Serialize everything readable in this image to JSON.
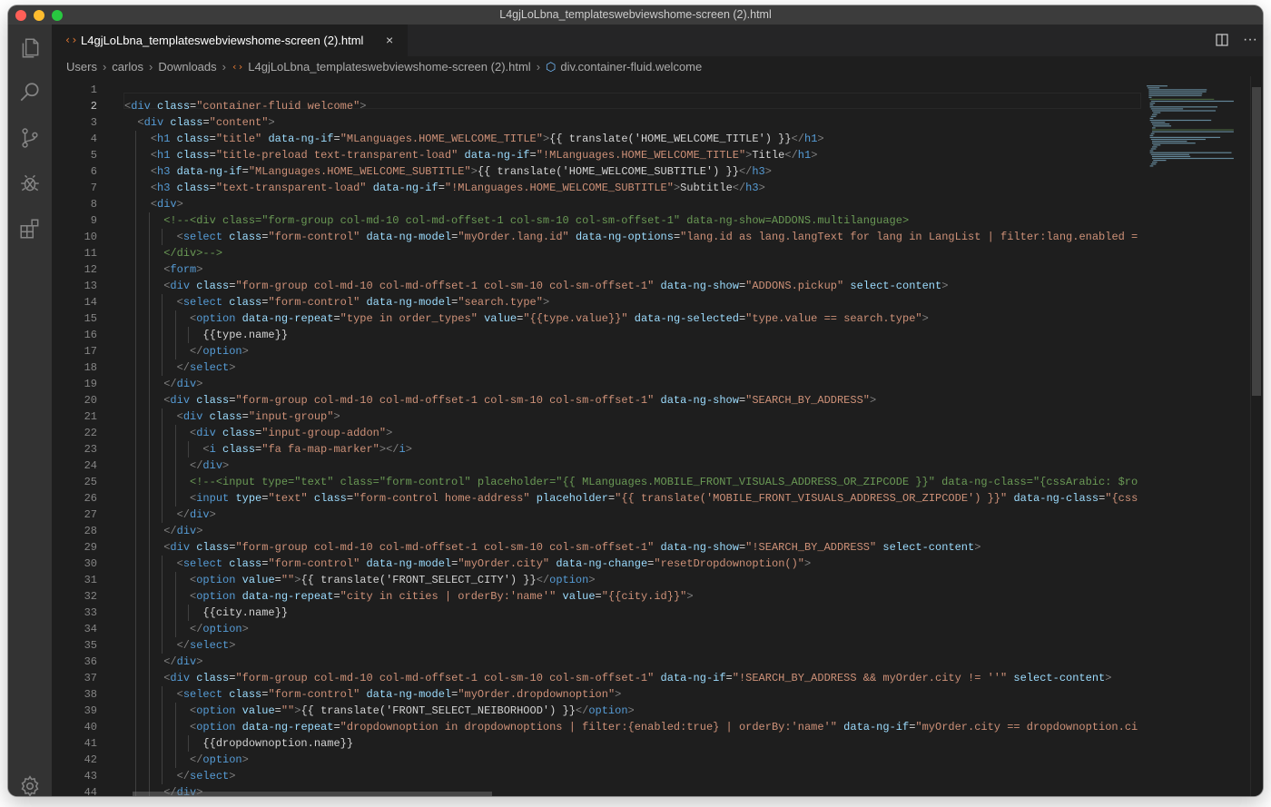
{
  "window": {
    "title": "L4gjLoLbna_templateswebviewshome-screen (2).html"
  },
  "activity_bar": {
    "items": [
      "explorer-icon",
      "search-icon",
      "source-control-icon",
      "run-debug-icon",
      "extensions-icon"
    ],
    "bottom": "settings-gear-icon"
  },
  "tabs": [
    {
      "label": "L4gjLoLbna_templateswebviewshome-screen (2).html",
      "icon": "‹›",
      "close": "×"
    }
  ],
  "tab_actions": {
    "split": "split-editor-icon",
    "more": "···"
  },
  "breadcrumb": {
    "items": [
      "Users",
      "carlos",
      "Downloads",
      "L4gjLoLbna_templateswebviewshome-screen (2).html",
      "div.container-fluid.welcome"
    ],
    "separator": "›"
  },
  "editor": {
    "active_line": 2,
    "line_numbers": [
      "1",
      "2",
      "3",
      "4",
      "5",
      "6",
      "7",
      "8",
      "9",
      "10",
      "11",
      "12",
      "13",
      "14",
      "15",
      "16",
      "17",
      "18",
      "19",
      "20",
      "21",
      "22",
      "23",
      "24",
      "25",
      "26",
      "27",
      "28",
      "29",
      "30",
      "31",
      "32",
      "33",
      "34",
      "35",
      "36",
      "37",
      "38",
      "39",
      "40",
      "41",
      "42",
      "43",
      "44"
    ],
    "lines": [
      "",
      "<div class=\"container-fluid welcome\">",
      "  <div class=\"content\">",
      "    <h1 class=\"title\" data-ng-if=\"MLanguages.HOME_WELCOME_TITLE\">{{ translate('HOME_WELCOME_TITLE') }}</h1>",
      "    <h1 class=\"title-preload text-transparent-load\" data-ng-if=\"!MLanguages.HOME_WELCOME_TITLE\">Title</h1>",
      "    <h3 data-ng-if=\"MLanguages.HOME_WELCOME_SUBTITLE\">{{ translate('HOME_WELCOME_SUBTITLE') }}</h3>",
      "    <h3 class=\"text-transparent-load\" data-ng-if=\"!MLanguages.HOME_WELCOME_SUBTITLE\">Subtitle</h3>",
      "    <div>",
      "      <!--<div class=\"form-group col-md-10 col-md-offset-1 col-sm-10 col-sm-offset-1\" data-ng-show=ADDONS.multilanguage>",
      "        <select class=\"form-control\" data-ng-model=\"myOrder.lang.id\" data-ng-options=\"lang.id as lang.langText for lang in LangList | filter:lang.enabled =",
      "      </div>-->",
      "      <form>",
      "      <div class=\"form-group col-md-10 col-md-offset-1 col-sm-10 col-sm-offset-1\" data-ng-show=\"ADDONS.pickup\" select-content>",
      "        <select class=\"form-control\" data-ng-model=\"search.type\">",
      "          <option data-ng-repeat=\"type in order_types\" value=\"{{type.value}}\" data-ng-selected=\"type.value == search.type\">",
      "            {{type.name}}",
      "          </option>",
      "        </select>",
      "      </div>",
      "      <div class=\"form-group col-md-10 col-md-offset-1 col-sm-10 col-sm-offset-1\" data-ng-show=\"SEARCH_BY_ADDRESS\">",
      "        <div class=\"input-group\">",
      "          <div class=\"input-group-addon\">",
      "            <i class=\"fa fa-map-marker\"></i>",
      "          </div>",
      "          <!--<input type=\"text\" class=\"form-control\" placeholder=\"{{ MLanguages.MOBILE_FRONT_VISUALS_ADDRESS_OR_ZIPCODE }}\" data-ng-class=\"{cssArabic: $ro",
      "          <input type=\"text\" class=\"form-control home-address\" placeholder=\"{{ translate('MOBILE_FRONT_VISUALS_ADDRESS_OR_ZIPCODE') }}\" data-ng-class=\"{css",
      "        </div>",
      "      </div>",
      "      <div class=\"form-group col-md-10 col-md-offset-1 col-sm-10 col-sm-offset-1\" data-ng-show=\"!SEARCH_BY_ADDRESS\" select-content>",
      "        <select class=\"form-control\" data-ng-model=\"myOrder.city\" data-ng-change=\"resetDropdownoption()\">",
      "          <option value=\"\">{{ translate('FRONT_SELECT_CITY') }}</option>",
      "          <option data-ng-repeat=\"city in cities | orderBy:'name'\" value=\"{{city.id}}\">",
      "            {{city.name}}",
      "          </option>",
      "        </select>",
      "      </div>",
      "      <div class=\"form-group col-md-10 col-md-offset-1 col-sm-10 col-sm-offset-1\" data-ng-if=\"!SEARCH_BY_ADDRESS && myOrder.city != ''\" select-content>",
      "        <select class=\"form-control\" data-ng-model=\"myOrder.dropdownoption\">",
      "          <option value=\"\">{{ translate('FRONT_SELECT_NEIBORHOOD') }}</option>",
      "          <option data-ng-repeat=\"dropdownoption in dropdownoptions | filter:{enabled:true} | orderBy:'name'\" data-ng-if=\"myOrder.city == dropdownoption.ci",
      "            {{dropdownoption.name}}",
      "          </option>",
      "        </select>",
      "      </div>"
    ]
  },
  "colors": {
    "tag": "#569cd6",
    "attribute": "#9cdcfe",
    "string": "#ce9178",
    "comment": "#6a9955",
    "text": "#d4d4d4",
    "bracket": "#808080",
    "background": "#1e1e1e"
  }
}
